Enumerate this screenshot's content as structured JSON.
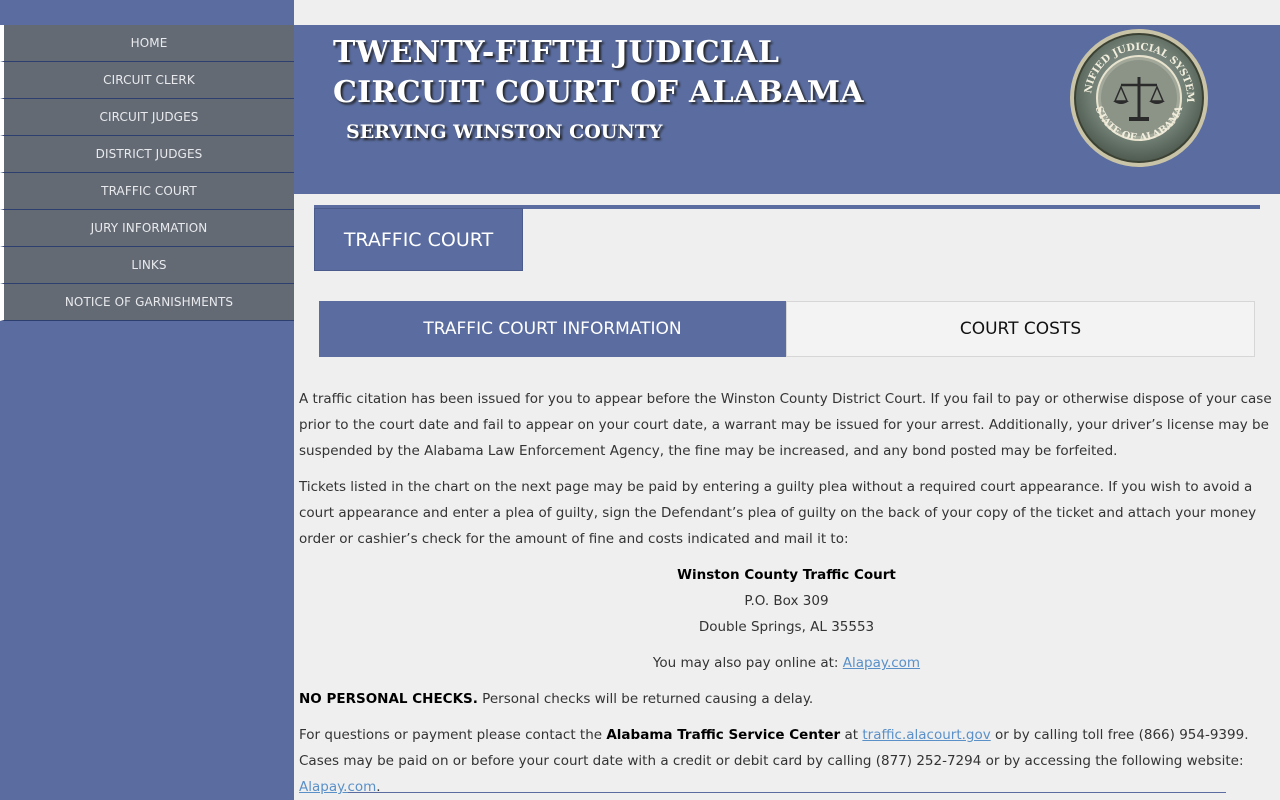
{
  "sidebar": {
    "items": [
      {
        "label": "HOME"
      },
      {
        "label": "CIRCUIT CLERK"
      },
      {
        "label": "CIRCUIT JUDGES"
      },
      {
        "label": "DISTRICT JUDGES"
      },
      {
        "label": "TRAFFIC COURT"
      },
      {
        "label": "JURY INFORMATION"
      },
      {
        "label": "LINKS"
      },
      {
        "label": "NOTICE OF GARNISHMENTS"
      }
    ]
  },
  "header": {
    "title_line1": "TWENTY-FIFTH JUDICIAL",
    "title_line2": "CIRCUIT COURT OF ALABAMA",
    "subtitle": "SERVING WINSTON COUNTY",
    "seal": {
      "top_text": "UNIFIED JUDICIAL SYSTEM",
      "bottom_text": "STATE OF ALABAMA"
    }
  },
  "page": {
    "title": "TRAFFIC COURT",
    "tabs": [
      {
        "label": "TRAFFIC COURT INFORMATION",
        "active": true
      },
      {
        "label": "COURT COSTS",
        "active": false
      }
    ],
    "para1": "A traffic citation has been issued for you to appear before the Winston County District Court. If you fail to pay or otherwise dispose of your case prior to the court date and fail to appear on your court date, a warrant may be issued for your arrest. Additionally, your driver’s license may be suspended by the Alabama Law Enforcement Agency, the fine may be increased, and any bond posted may be forfeited.",
    "para2": "Tickets listed in the chart on the next page may be paid by entering a guilty plea without a required court appearance. If you wish to avoid a court appearance and enter a plea of guilty, sign the Defendant’s plea of guilty on the back of your copy of the ticket and attach your money order or cashier’s check for the amount of fine and costs indicated and mail it to:",
    "address": {
      "name": "Winston County Traffic Court",
      "line1": "P.O. Box 309",
      "line2": "Double Springs, AL 35553"
    },
    "online_prefix": "You may also pay online at: ",
    "online_link": "Alapay.com",
    "no_checks_bold": "NO PERSONAL CHECKS.",
    "no_checks_rest": " Personal checks will be returned causing a delay.",
    "contact_prefix": "For questions or payment please contact the ",
    "contact_bold": "Alabama Traffic Service Center",
    "contact_at": " at ",
    "contact_link": "traffic.alacourt.gov",
    "contact_rest": " or by calling toll free (866) 954-9399. Cases may be paid on or before your court date with a credit or debit card by calling (877) 252-7294 or by accessing the following website: ",
    "contact_link2": "Alapay.com",
    "contact_end": "."
  },
  "colors": {
    "brand_blue": "#5b6da0",
    "nav_gray": "#636a73",
    "link": "#5a90c8"
  }
}
